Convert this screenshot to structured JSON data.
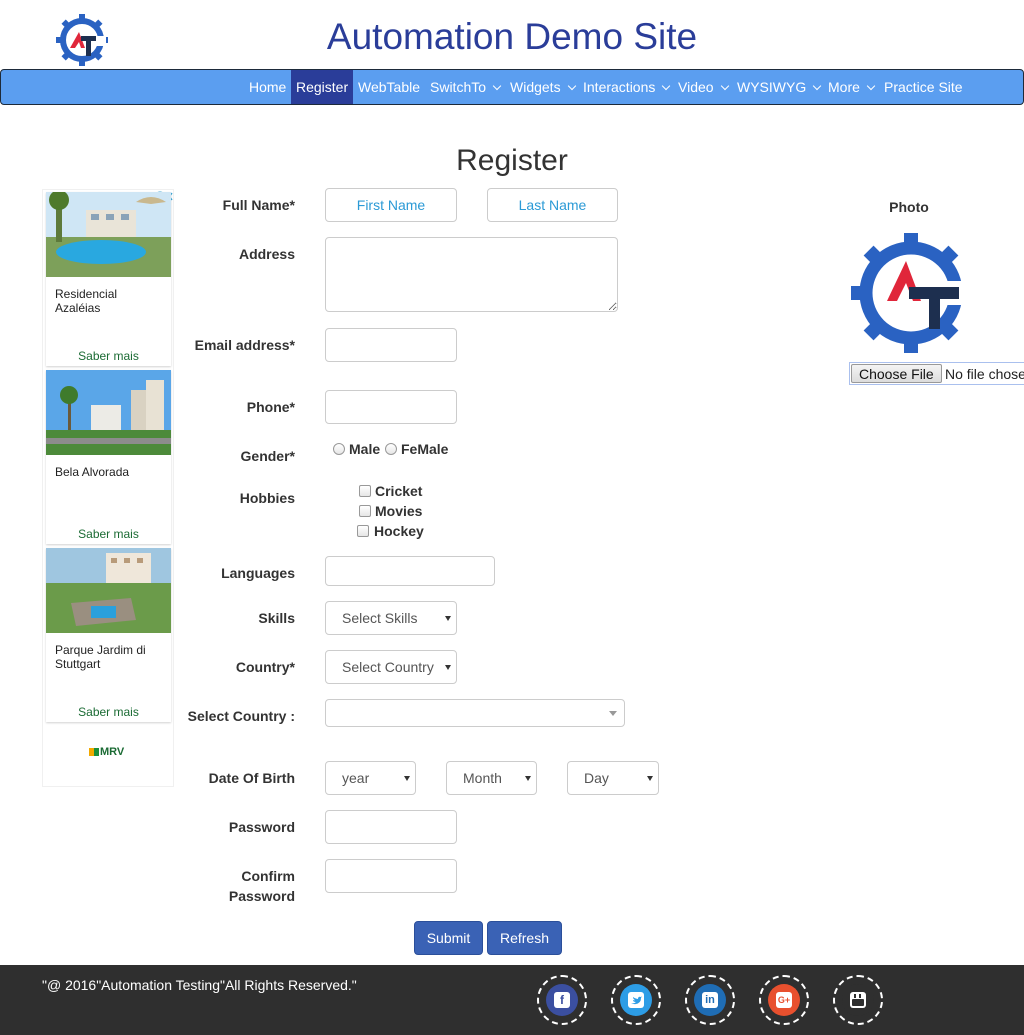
{
  "header": {
    "title": "Automation Demo Site"
  },
  "nav": {
    "items": [
      {
        "label": "Home"
      },
      {
        "label": "Register"
      },
      {
        "label": "WebTable"
      },
      {
        "label": "SwitchTo"
      },
      {
        "label": "Widgets"
      },
      {
        "label": "Interactions"
      },
      {
        "label": "Video"
      },
      {
        "label": "WYSIWYG"
      },
      {
        "label": "More"
      },
      {
        "label": "Practice Site"
      }
    ],
    "active": "Register",
    "colors": {
      "bar": "#5b9ef0",
      "active": "#2a3d99"
    }
  },
  "page": {
    "title": "Register"
  },
  "ads": {
    "cards": [
      {
        "name": "Residencial Azaléias",
        "link": "Saber mais"
      },
      {
        "name": "Bela Alvorada",
        "link": "Saber mais"
      },
      {
        "name": "Parque Jardim di Stuttgart",
        "link": "Saber mais"
      }
    ],
    "brand": "MRV"
  },
  "form": {
    "full_name": {
      "label": "Full Name*",
      "first_placeholder": "First Name",
      "last_placeholder": "Last Name"
    },
    "address": {
      "label": "Address"
    },
    "email": {
      "label": "Email address*"
    },
    "phone": {
      "label": "Phone*"
    },
    "gender": {
      "label": "Gender*",
      "options": [
        "Male",
        "FeMale"
      ]
    },
    "hobbies": {
      "label": "Hobbies",
      "options": [
        "Cricket",
        "Movies",
        "Hockey"
      ]
    },
    "languages": {
      "label": "Languages"
    },
    "skills": {
      "label": "Skills",
      "value": "Select Skills"
    },
    "country": {
      "label": "Country*",
      "value": "Select Country"
    },
    "select_country": {
      "label": "Select Country :",
      "value": ""
    },
    "dob": {
      "label": "Date Of Birth",
      "year": "year",
      "month": "Month",
      "day": "Day"
    },
    "password": {
      "label": "Password"
    },
    "confirm_password": {
      "label": "Confirm Password"
    },
    "submit": "Submit",
    "refresh": "Refresh",
    "button_color": "#3a62b5"
  },
  "photo": {
    "label": "Photo",
    "choose_file": "Choose File",
    "no_file": "No file chosen"
  },
  "footer": {
    "copyright": "\"@ 2016\"Automation Testing\"All Rights Reserved.\"",
    "social": [
      {
        "icon": "facebook-icon",
        "color": "#3b4fa0"
      },
      {
        "icon": "twitter-icon",
        "color": "#2d9de6"
      },
      {
        "icon": "linkedin-icon",
        "color": "#1f6db5"
      },
      {
        "icon": "google-plus-icon",
        "color": "#e8502e"
      },
      {
        "icon": "youtube-icon",
        "color": "#2f2f2f"
      }
    ]
  }
}
